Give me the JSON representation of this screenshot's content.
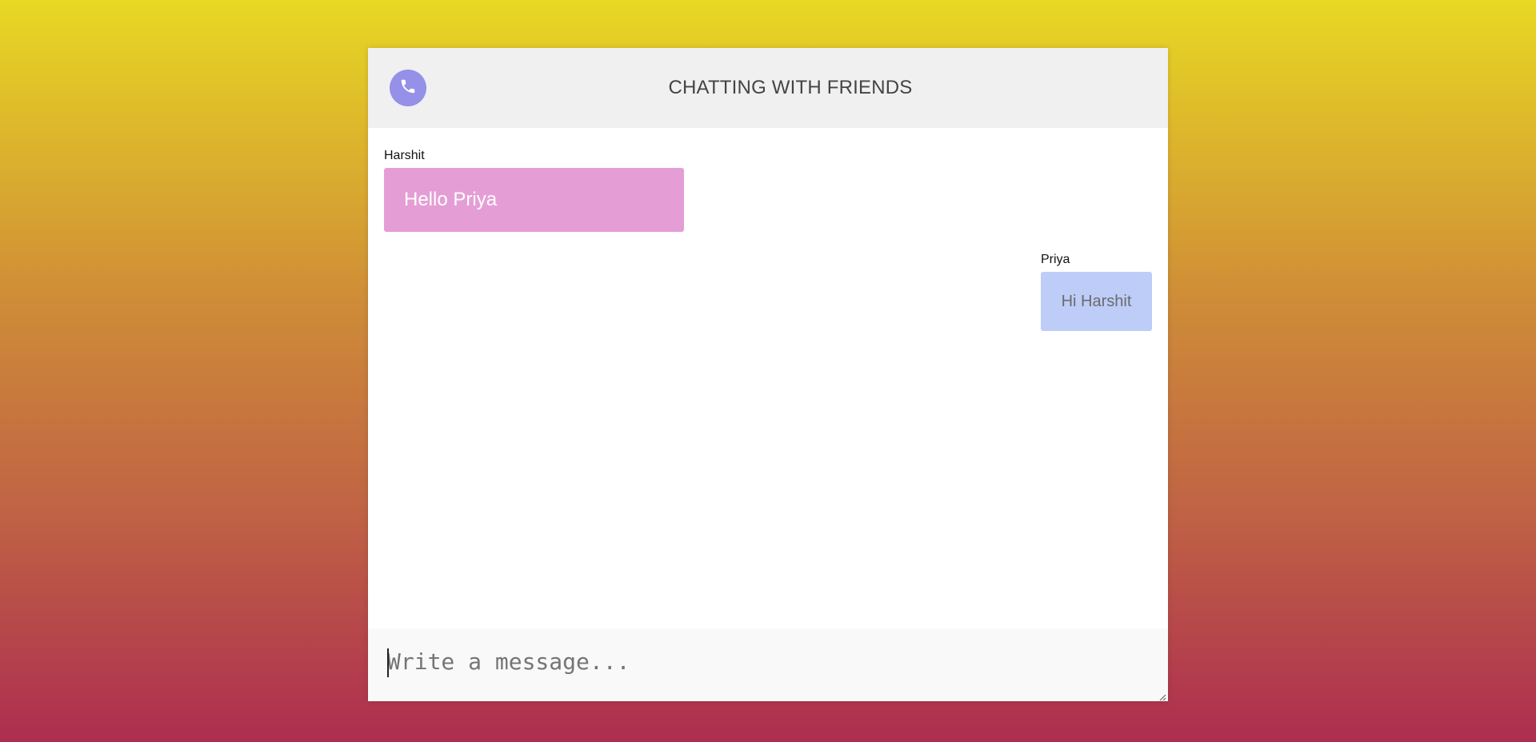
{
  "header": {
    "title": "CHATTING WITH FRIENDS",
    "call_icon": "phone-icon"
  },
  "messages": [
    {
      "sender": "Harshit",
      "text": "Hello Priya",
      "side": "left",
      "color": "#e59ed5"
    },
    {
      "sender": "Priya",
      "text": "Hi Harshit",
      "side": "right",
      "color": "#bdcdf8"
    }
  ],
  "composer": {
    "value": "",
    "placeholder": "Write a message..."
  },
  "colors": {
    "accent": "#9590e8",
    "header_bg": "#f0f0f0",
    "background_top": "#e8d823",
    "background_bottom": "#ad2d4f"
  }
}
